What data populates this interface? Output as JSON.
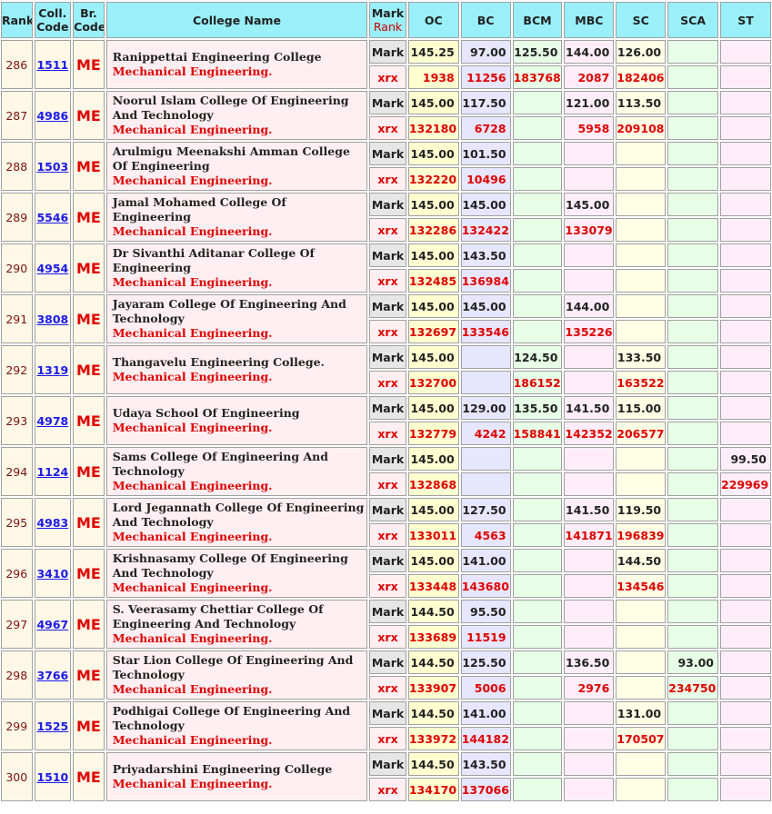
{
  "headers": {
    "rank": "Rank",
    "coll_code_1": "Coll.",
    "coll_code_2": "Code",
    "br_code_1": "Br.",
    "br_code_2": "Code",
    "college_name": "College Name",
    "mark": "Mark",
    "rank_sub": "Rank",
    "categories": [
      "OC",
      "BC",
      "BCM",
      "MBC",
      "SC",
      "SCA",
      "ST"
    ]
  },
  "row_labels": {
    "mark": "Mark",
    "rank": "xrx"
  },
  "colors": {
    "header_bg": "#99f0f8",
    "branch_red": "#e00000",
    "link_blue": "#1a1aee"
  },
  "rows": [
    {
      "rank": "286",
      "code": "1511",
      "branch": "ME",
      "college": "Ranippettai Engineering College",
      "course": "Mechanical Engineering.",
      "marks": [
        "145.25",
        "97.00",
        "125.50",
        "144.00",
        "126.00",
        "",
        ""
      ],
      "ranks": [
        "1938",
        "11256",
        "183768",
        "2087",
        "182406",
        "",
        ""
      ]
    },
    {
      "rank": "287",
      "code": "4986",
      "branch": "ME",
      "college": "Noorul Islam College Of Engineering And Technology",
      "course": "Mechanical Engineering.",
      "marks": [
        "145.00",
        "117.50",
        "",
        "121.00",
        "113.50",
        "",
        ""
      ],
      "ranks": [
        "132180",
        "6728",
        "",
        "5958",
        "209108",
        "",
        ""
      ]
    },
    {
      "rank": "288",
      "code": "1503",
      "branch": "ME",
      "college": "Arulmigu Meenakshi Amman College Of Engineering",
      "course": "Mechanical Engineering.",
      "marks": [
        "145.00",
        "101.50",
        "",
        "",
        "",
        "",
        ""
      ],
      "ranks": [
        "132220",
        "10496",
        "",
        "",
        "",
        "",
        ""
      ]
    },
    {
      "rank": "289",
      "code": "5546",
      "branch": "ME",
      "college": "Jamal Mohamed College Of Engineering",
      "course": "Mechanical Engineering.",
      "marks": [
        "145.00",
        "145.00",
        "",
        "145.00",
        "",
        "",
        ""
      ],
      "ranks": [
        "132286",
        "132422",
        "",
        "133079",
        "",
        "",
        ""
      ]
    },
    {
      "rank": "290",
      "code": "4954",
      "branch": "ME",
      "college": "Dr Sivanthi Aditanar College Of Engineering",
      "course": "Mechanical Engineering.",
      "marks": [
        "145.00",
        "143.50",
        "",
        "",
        "",
        "",
        ""
      ],
      "ranks": [
        "132485",
        "136984",
        "",
        "",
        "",
        "",
        ""
      ]
    },
    {
      "rank": "291",
      "code": "3808",
      "branch": "ME",
      "college": "Jayaram College Of Engineering And Technology",
      "course": "Mechanical Engineering.",
      "marks": [
        "145.00",
        "145.00",
        "",
        "144.00",
        "",
        "",
        ""
      ],
      "ranks": [
        "132697",
        "133546",
        "",
        "135226",
        "",
        "",
        ""
      ]
    },
    {
      "rank": "292",
      "code": "1319",
      "branch": "ME",
      "college": "Thangavelu Engineering College.",
      "course": "Mechanical Engineering.",
      "marks": [
        "145.00",
        "",
        "124.50",
        "",
        "133.50",
        "",
        ""
      ],
      "ranks": [
        "132700",
        "",
        "186152",
        "",
        "163522",
        "",
        ""
      ]
    },
    {
      "rank": "293",
      "code": "4978",
      "branch": "ME",
      "college": "Udaya School Of Engineering",
      "course": "Mechanical Engineering.",
      "marks": [
        "145.00",
        "129.00",
        "135.50",
        "141.50",
        "115.00",
        "",
        ""
      ],
      "ranks": [
        "132779",
        "4242",
        "158841",
        "142352",
        "206577",
        "",
        ""
      ]
    },
    {
      "rank": "294",
      "code": "1124",
      "branch": "ME",
      "college": "Sams College Of Engineering And Technology",
      "course": "Mechanical Engineering.",
      "marks": [
        "145.00",
        "",
        "",
        "",
        "",
        "",
        "99.50"
      ],
      "ranks": [
        "132868",
        "",
        "",
        "",
        "",
        "",
        "229969"
      ]
    },
    {
      "rank": "295",
      "code": "4983",
      "branch": "ME",
      "college": "Lord Jegannath College Of Engineering And Technology",
      "course": "Mechanical Engineering.",
      "marks": [
        "145.00",
        "127.50",
        "",
        "141.50",
        "119.50",
        "",
        ""
      ],
      "ranks": [
        "133011",
        "4563",
        "",
        "141871",
        "196839",
        "",
        ""
      ]
    },
    {
      "rank": "296",
      "code": "3410",
      "branch": "ME",
      "college": "Krishnasamy College Of Engineering And Technology",
      "course": "Mechanical Engineering.",
      "marks": [
        "145.00",
        "141.00",
        "",
        "",
        "144.50",
        "",
        ""
      ],
      "ranks": [
        "133448",
        "143680",
        "",
        "",
        "134546",
        "",
        ""
      ]
    },
    {
      "rank": "297",
      "code": "4967",
      "branch": "ME",
      "college": "S. Veerasamy Chettiar College Of Engineering And Technology",
      "course": "Mechanical Engineering.",
      "marks": [
        "144.50",
        "95.50",
        "",
        "",
        "",
        "",
        ""
      ],
      "ranks": [
        "133689",
        "11519",
        "",
        "",
        "",
        "",
        ""
      ]
    },
    {
      "rank": "298",
      "code": "3766",
      "branch": "ME",
      "college": "Star Lion College Of Engineering And Technology",
      "course": "Mechanical Engineering.",
      "marks": [
        "144.50",
        "125.50",
        "",
        "136.50",
        "",
        "93.00",
        ""
      ],
      "ranks": [
        "133907",
        "5006",
        "",
        "2976",
        "",
        "234750",
        ""
      ]
    },
    {
      "rank": "299",
      "code": "1525",
      "branch": "ME",
      "college": "Podhigai College Of Engineering And Technology",
      "course": "Mechanical Engineering.",
      "marks": [
        "144.50",
        "141.00",
        "",
        "",
        "131.00",
        "",
        ""
      ],
      "ranks": [
        "133972",
        "144182",
        "",
        "",
        "170507",
        "",
        ""
      ]
    },
    {
      "rank": "300",
      "code": "1510",
      "branch": "ME",
      "college": "Priyadarshini Engineering College",
      "course": "Mechanical Engineering.",
      "marks": [
        "144.50",
        "143.50",
        "",
        "",
        "",
        "",
        ""
      ],
      "ranks": [
        "134170",
        "137066",
        "",
        "",
        "",
        "",
        ""
      ]
    }
  ]
}
